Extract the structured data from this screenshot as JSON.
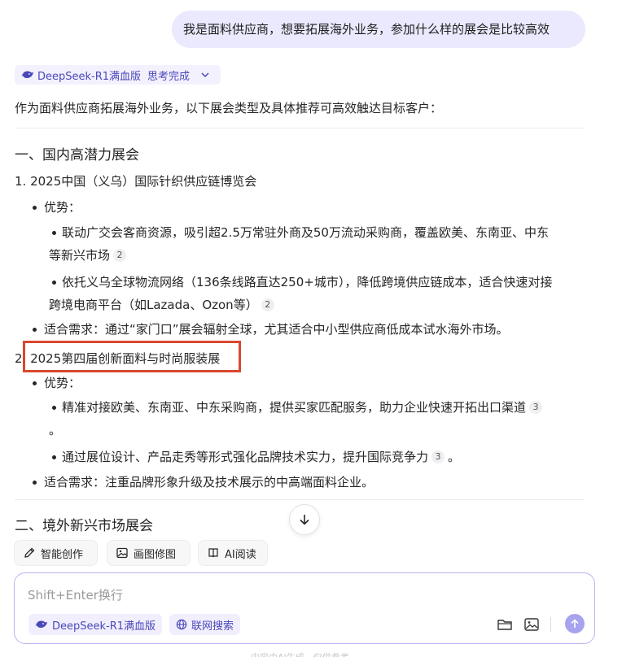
{
  "user_message": "我是面料供应商，想要拓展海外业务，参加什么样的展会是比较高效",
  "model_chip": {
    "name": "DeepSeek-R1满血版",
    "status": "思考完成"
  },
  "answer": {
    "intro": "作为面料供应商拓展海外业务，以下展会类型及具体推荐可高效触达目标客户：",
    "section1_title": "一、国内高潜力展会",
    "item1": {
      "title": "1. 2025中国（义乌）国际针织供应链博览会",
      "advantage_label": "优势：",
      "adv1_line1": "联动广交会客商资源，吸引超2.5万常驻外商及50万流动采购商，覆盖欧美、东南亚、中东",
      "adv1_line2": "等新兴市场",
      "adv1_cite": "2",
      "adv2_line1": "依托义乌全球物流网络（136条线路直达250+城市），降低跨境供应链成本，适合快速对接",
      "adv2_line2": "跨境电商平台（如Lazada、Ozon等）",
      "adv2_cite": "2",
      "fit": "适合需求：通过“家门口”展会辐射全球，尤其适合中小型供应商低成本试水海外市场。"
    },
    "item2": {
      "title": "2. 2025第四届创新面料与时尚服装展",
      "advantage_label": "优势：",
      "adv1_line1": "精准对接欧美、东南亚、中东采购商，提供买家匹配服务，助力企业快速开拓出口渠道",
      "adv1_cite": "3",
      "adv1_line2": "。",
      "adv2_text": "通过展位设计、产品走秀等形式强化品牌技术实力，提升国际竞争力",
      "adv2_cite": "3",
      "adv2_end": "。",
      "fit": "适合需求：注重品牌形象升级及技术展示的中高端面料企业。"
    },
    "section2_title": "二、境外新兴市场展会"
  },
  "tools": [
    {
      "label": "智能创作",
      "icon": "pen-icon"
    },
    {
      "label": "画图修图",
      "icon": "image-icon"
    },
    {
      "label": "AI阅读",
      "icon": "book-icon"
    }
  ],
  "composer": {
    "placeholder": "Shift+Enter换行",
    "model_pill": "DeepSeek-R1满血版",
    "search_pill": "联网搜索"
  },
  "footer_note": "内容由AI生成，仅供参考",
  "colors": {
    "accent": "#4b48b8",
    "bubble": "#eae9fd",
    "highlight": "#d9482d"
  }
}
